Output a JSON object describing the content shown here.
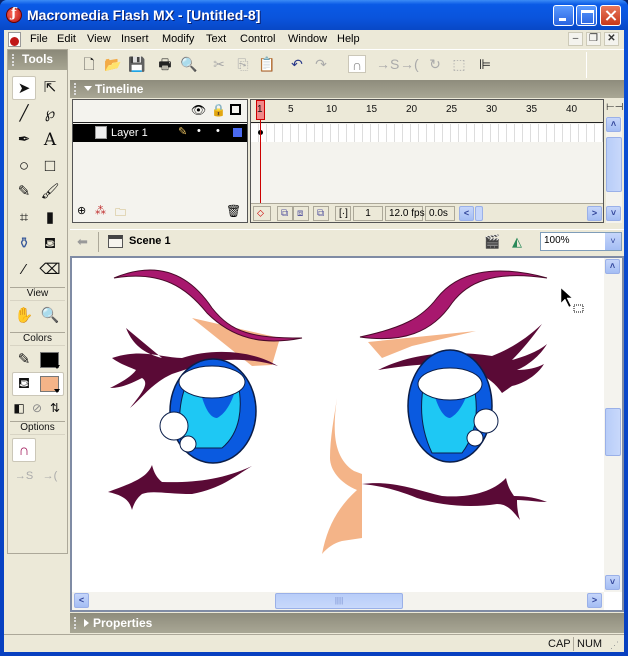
{
  "window": {
    "title": "Macromedia Flash MX - [Untitled-8]"
  },
  "menubar": {
    "items": [
      "File",
      "Edit",
      "View",
      "Insert",
      "Modify",
      "Text",
      "Control",
      "Window",
      "Help"
    ]
  },
  "toolbar": {
    "buttons": [
      "new-file",
      "open",
      "save",
      "print",
      "print-preview",
      "cut",
      "copy",
      "paste",
      "undo",
      "redo",
      "snap-to-objects",
      "smooth",
      "straighten",
      "rotate",
      "scale",
      "align"
    ]
  },
  "tools": {
    "title": "Tools",
    "view_label": "View",
    "colors_label": "Colors",
    "options_label": "Options",
    "items": [
      "arrow",
      "subselection",
      "line",
      "lasso",
      "pen",
      "text",
      "oval",
      "rectangle",
      "pencil",
      "brush",
      "free-transform",
      "fill-transform",
      "ink-bottle",
      "paint-bucket",
      "eyedropper",
      "eraser"
    ],
    "stroke_color": "#000000",
    "fill_color": "#f4b488"
  },
  "timeline": {
    "title": "Timeline",
    "layer_name": "Layer 1",
    "ruler_labels": [
      "1",
      "5",
      "10",
      "15",
      "20",
      "25",
      "30",
      "35",
      "40"
    ],
    "current_frame": "1",
    "frame_rate": "12.0 fps",
    "elapsed_time": "0.0s"
  },
  "editbar": {
    "scene": "Scene 1",
    "zoom": "100%"
  },
  "properties": {
    "title": "Properties"
  },
  "status": {
    "cap": "CAP",
    "num": "NUM"
  },
  "colors": {
    "brow": "#a8186e",
    "lash": "#5a0a36",
    "iris_outer": "#0a5ae0",
    "iris_inner": "#1ec8f4",
    "skin": "#f4b488"
  }
}
